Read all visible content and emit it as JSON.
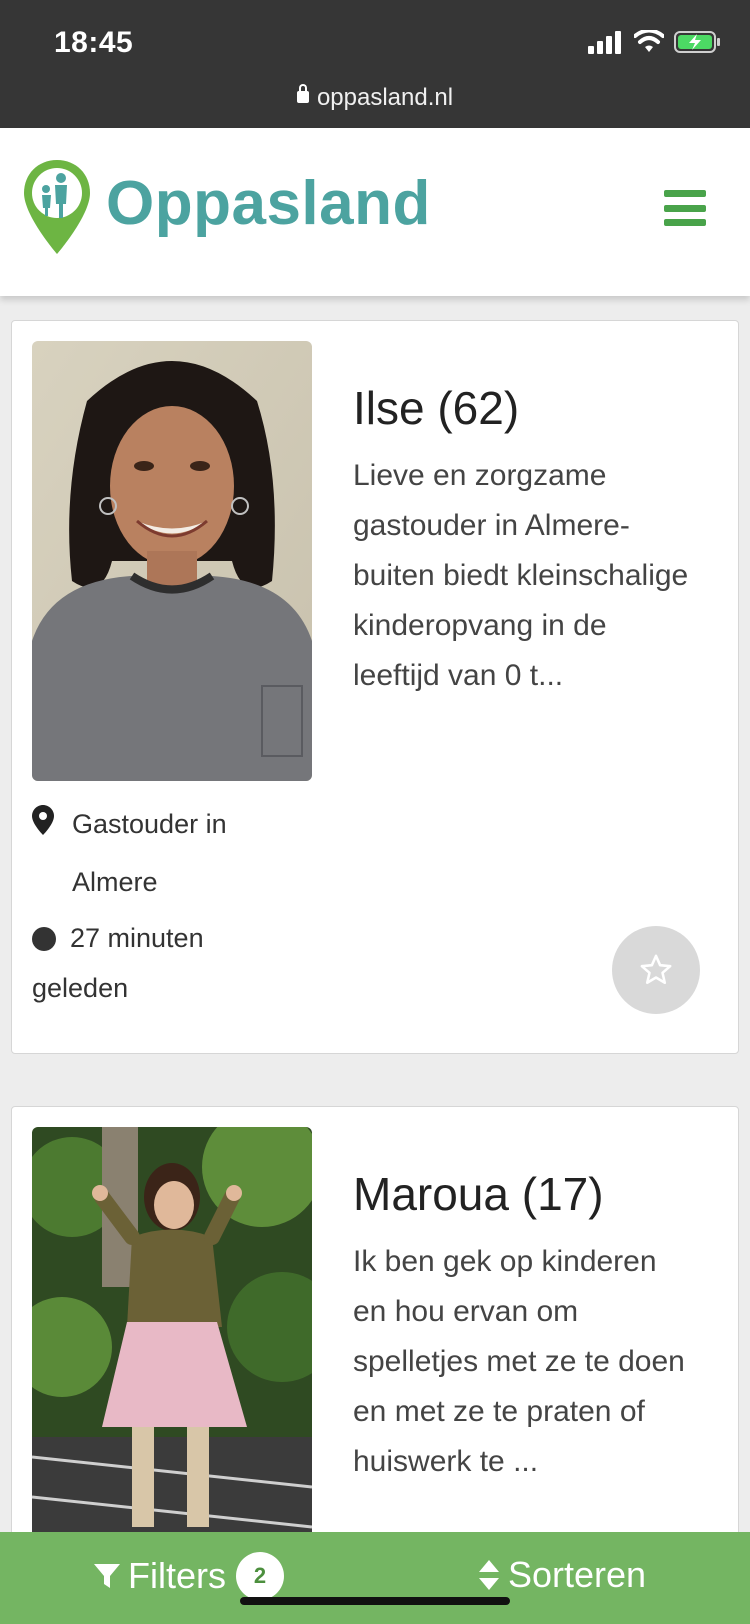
{
  "status_bar": {
    "time": "18:45",
    "url": "oppasland.nl"
  },
  "header": {
    "brand": "Oppasland",
    "accent_color": "#4ca3a0",
    "menu_color": "#49a34a"
  },
  "listings": [
    {
      "name": "Ilse (62)",
      "description": "Lieve en zorgzame gastouder in Almere-buiten biedt kleinschalige kinderopvang in de leeftijd van 0 t...",
      "location": "Gastouder in Almere",
      "last_seen": "27 minuten geleden",
      "favorite_icon": "star-outline-icon"
    },
    {
      "name": "Maroua (17)",
      "description": "Ik ben gek op kinderen en hou ervan om spelletjes met ze te doen en met ze te praten of huiswerk te ..."
    }
  ],
  "bottom_bar": {
    "filters_label": "Filters",
    "filters_count": "2",
    "sort_label": "Sorteren",
    "bar_color": "#74b562"
  }
}
